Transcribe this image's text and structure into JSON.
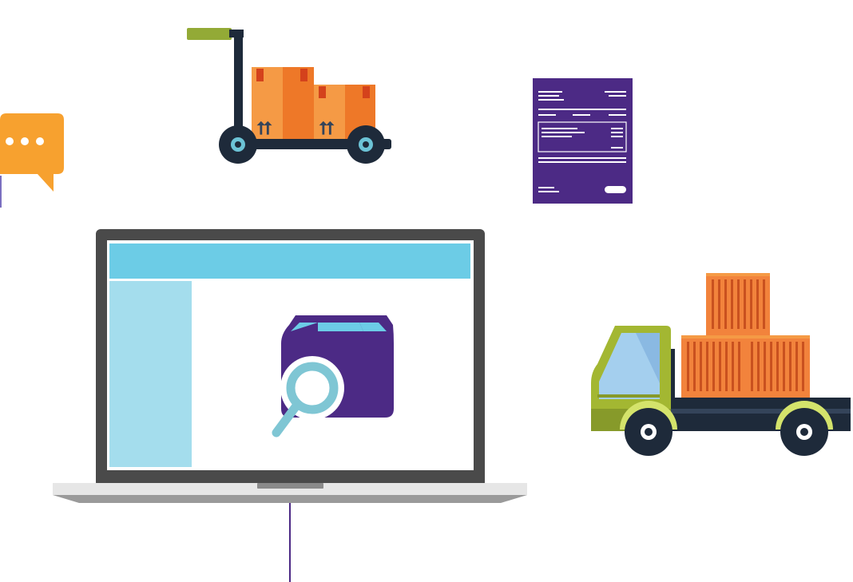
{
  "illustration": {
    "items": [
      {
        "id": "chat",
        "icon": "chat-bubble-icon"
      },
      {
        "id": "hand_truck",
        "icon": "hand-truck-with-boxes-icon"
      },
      {
        "id": "invoice",
        "icon": "invoice-document-icon"
      },
      {
        "id": "laptop",
        "icon": "laptop-package-search-icon"
      },
      {
        "id": "truck",
        "icon": "delivery-truck-with-containers-icon"
      }
    ],
    "colors": {
      "orange": "#F7A12F",
      "box_orange": "#F59A45",
      "box_orange_dark": "#EE7828",
      "container_orange": "#F2833C",
      "navy": "#1E2A3A",
      "purple": "#4C2A85",
      "sky_blue": "#6CCCE6",
      "light_blue": "#A4DDED",
      "laptop_gray": "#4A4A4A",
      "truck_green": "#A3B732",
      "handle_green": "#93AA36"
    }
  }
}
